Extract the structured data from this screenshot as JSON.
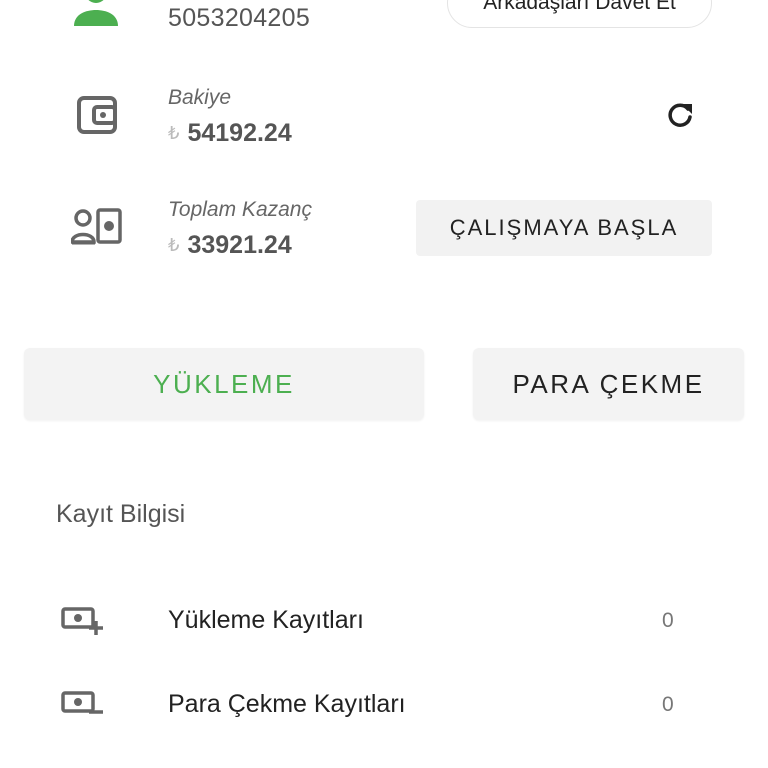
{
  "user": {
    "phone": "5053204205"
  },
  "invite_button": {
    "label": "Arkadaşları Davet Et"
  },
  "balance": {
    "label": "Bakiye",
    "currency_symbol": "₺",
    "amount": "54192.24"
  },
  "earnings": {
    "label": "Toplam Kazanç",
    "currency_symbol": "₺",
    "amount": "33921.24"
  },
  "actions": {
    "start_work_label": "ÇALIŞMAYA BAŞLA",
    "load_label": "YÜKLEME",
    "withdraw_label": "PARA ÇEKME"
  },
  "records": {
    "title": "Kayıt Bilgisi",
    "items": [
      {
        "label": "Yükleme Kayıtları",
        "count": "0",
        "icon": "cash-plus-icon"
      },
      {
        "label": "Para Çekme Kayıtları",
        "count": "0",
        "icon": "cash-minus-icon"
      }
    ]
  },
  "colors": {
    "accent_green": "#4caf50",
    "icon_gray": "#666666",
    "button_bg": "#f3f3f3"
  }
}
